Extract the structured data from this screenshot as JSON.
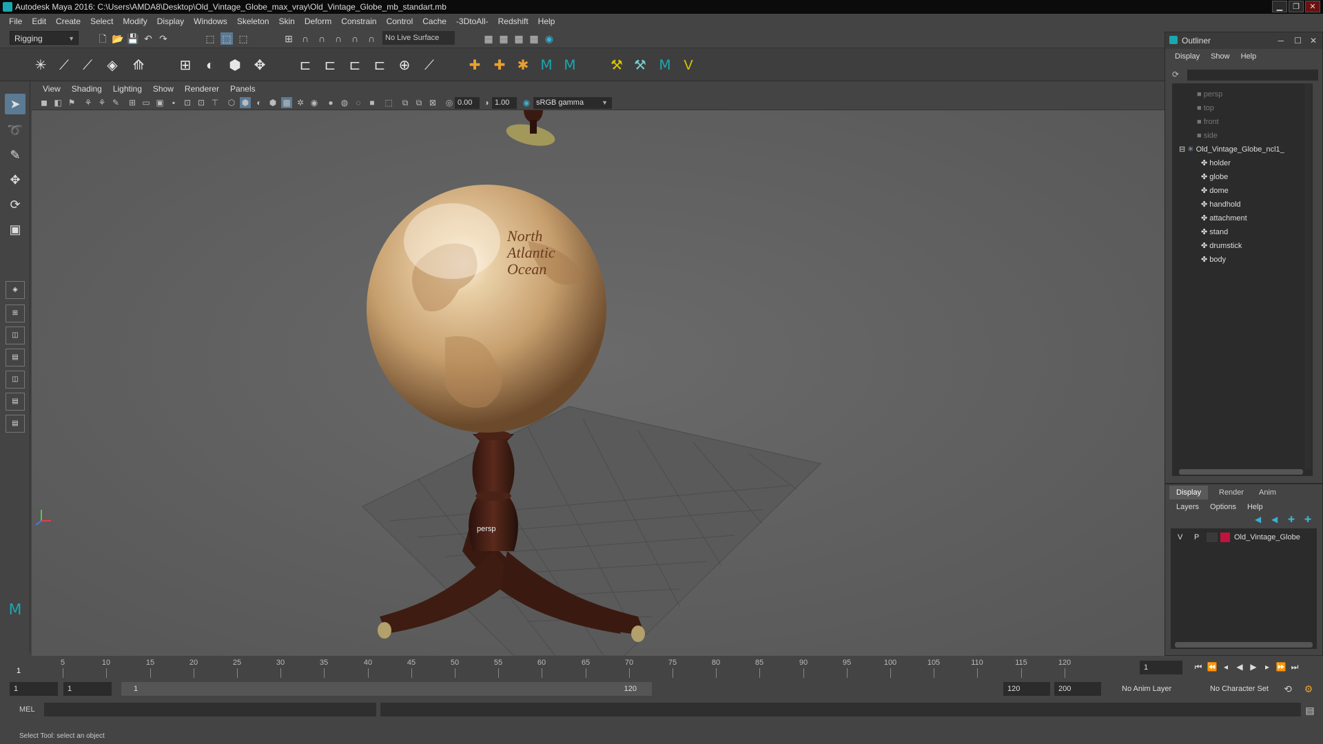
{
  "window": {
    "title": "Autodesk Maya 2016: C:\\Users\\AMDA8\\Desktop\\Old_Vintage_Globe_max_vray\\Old_Vintage_Globe_mb_standart.mb",
    "minimize": "▁",
    "restore": "❐",
    "close": "✕"
  },
  "menubar": [
    "File",
    "Edit",
    "Create",
    "Select",
    "Modify",
    "Display",
    "Windows",
    "Skeleton",
    "Skin",
    "Deform",
    "Constrain",
    "Control",
    "Cache",
    "-3DtoAll-",
    "Redshift",
    "Help"
  ],
  "statusline": {
    "mode": "Rigging",
    "live_surface": "No Live Surface"
  },
  "viewport": {
    "menu": [
      "View",
      "Shading",
      "Lighting",
      "Show",
      "Renderer",
      "Panels"
    ],
    "exposure": "0.00",
    "gamma": "1.00",
    "color_space": "sRGB gamma",
    "camera_label": "persp",
    "globe_text": [
      "North",
      "Atlantic",
      "Ocean"
    ]
  },
  "timeline": {
    "ticks": [
      "5",
      "10",
      "15",
      "20",
      "25",
      "30",
      "35",
      "40",
      "45",
      "50",
      "55",
      "60",
      "65",
      "70",
      "75",
      "80",
      "85",
      "90",
      "95",
      "100",
      "105",
      "110",
      "115",
      "120"
    ],
    "start_label": "1",
    "current_frame": "1"
  },
  "range": {
    "start": "1",
    "playback_start": "1",
    "slider_start": "1",
    "slider_end": "120",
    "playback_end": "120",
    "end": "200",
    "anim_layer": "No Anim Layer",
    "character_set": "No Character Set"
  },
  "cmdline": {
    "label": "MEL"
  },
  "helpline": "Select Tool: select an object",
  "outliner": {
    "title": "Outliner",
    "menu": [
      "Display",
      "Show",
      "Help"
    ],
    "cameras": [
      "persp",
      "top",
      "front",
      "side"
    ],
    "group": "Old_Vintage_Globe_ncl1_",
    "children": [
      "holder",
      "globe",
      "dome",
      "handhold",
      "attachment",
      "stand",
      "drumstick",
      "body"
    ]
  },
  "layers": {
    "tabs": [
      "Display",
      "Render",
      "Anim"
    ],
    "menu": [
      "Layers",
      "Options",
      "Help"
    ],
    "row": {
      "v": "V",
      "p": "P",
      "name": "Old_Vintage_Globe",
      "color": "#c0143c"
    }
  }
}
